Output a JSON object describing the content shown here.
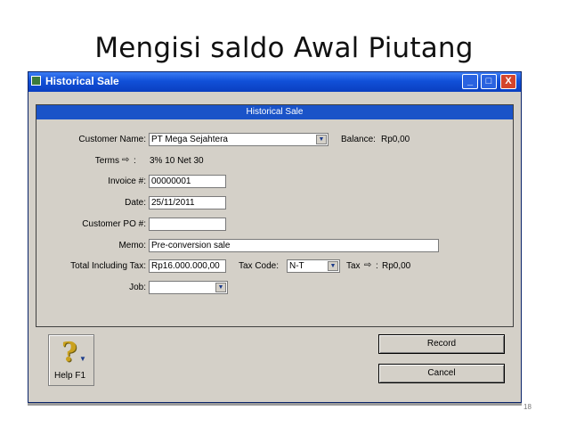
{
  "slide": {
    "title": "Mengisi saldo Awal Piutang",
    "page_number": "18"
  },
  "window": {
    "title": "Historical Sale",
    "controls": [
      "_",
      "□",
      "X"
    ]
  },
  "panel": {
    "header": "Historical Sale"
  },
  "form": {
    "customer_name": {
      "label": "Customer Name:",
      "value": "PT Mega Sejahtera"
    },
    "balance": {
      "label": "Balance:",
      "value": "Rp0,00"
    },
    "terms": {
      "label": "Terms",
      "value": "3% 10 Net 30"
    },
    "invoice": {
      "label": "Invoice #:",
      "value": "00000001"
    },
    "date": {
      "label": "Date:",
      "value": "25/11/2011"
    },
    "customer_po": {
      "label": "Customer PO #:",
      "value": ""
    },
    "memo": {
      "label": "Memo:",
      "value": "Pre-conversion sale"
    },
    "total": {
      "label": "Total Including Tax:",
      "value": "Rp16.000.000,00"
    },
    "tax_code": {
      "label": "Tax Code:",
      "value": "N-T"
    },
    "tax": {
      "label": "Tax",
      "value": "Rp0,00"
    },
    "job": {
      "label": "Job:",
      "value": ""
    }
  },
  "buttons": {
    "help": "Help F1",
    "record": "Record",
    "cancel": "Cancel"
  },
  "icons": {
    "arrow": "⇨",
    "dropdown": "▼",
    "help": "?"
  }
}
